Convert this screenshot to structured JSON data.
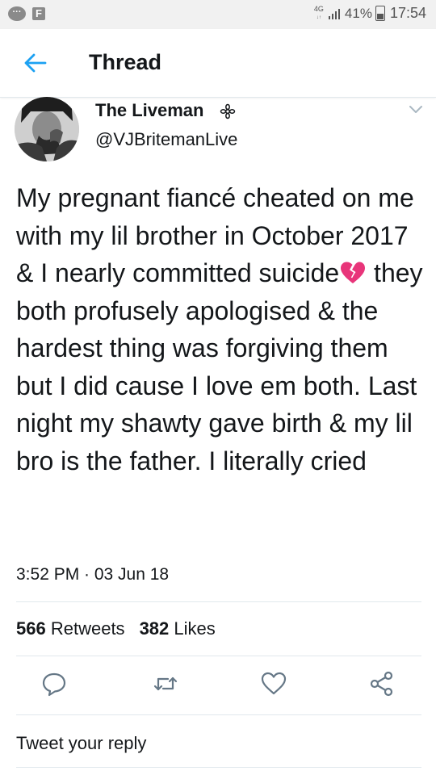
{
  "status_bar": {
    "network": "4G",
    "battery": "41%",
    "time": "17:54"
  },
  "header": {
    "title": "Thread"
  },
  "tweet": {
    "user_name": "The Liveman",
    "handle": "@VJBritemanLive",
    "text_part1": "My pregnant fiancé cheated on me with my lil brother in October 2017 & I nearly committed suicide",
    "emoji": "broken-heart-icon",
    "text_part2": " they both profusely apologised & the hardest thing was forgiving them but I did cause I love em both. Last night my shawty gave birth & my lil bro is the father. I literally cried",
    "timestamp": "3:52 PM · 03 Jun 18",
    "retweets_count": "566",
    "retweets_label": "Retweets",
    "likes_count": "382",
    "likes_label": "Likes"
  },
  "actions": [
    "reply-icon",
    "retweet-icon",
    "like-icon",
    "share-icon"
  ],
  "reply_placeholder": "Tweet your reply",
  "colors": {
    "accent": "#1da1f2",
    "icon_gray": "#657786",
    "broken_heart": "#e8357a"
  }
}
